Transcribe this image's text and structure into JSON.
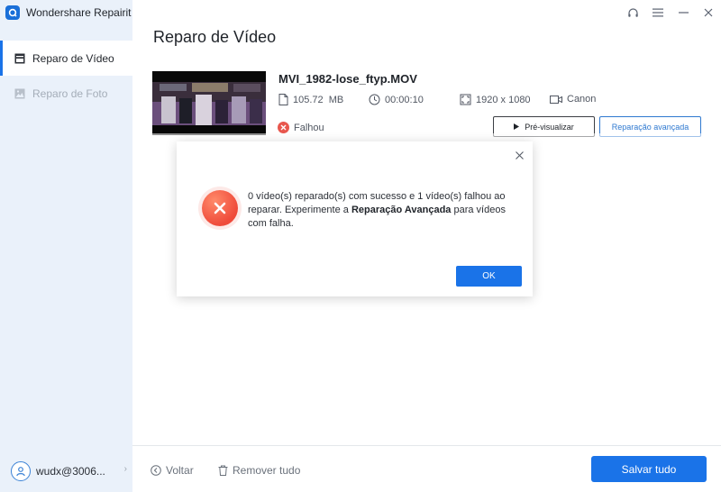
{
  "app": {
    "title": "Wondershare Repairit"
  },
  "sidebar": {
    "items": [
      {
        "label": "Reparo de Vídeo",
        "active": true,
        "icon": "video-repair-icon"
      },
      {
        "label": "Reparo de Foto",
        "active": false,
        "icon": "photo-repair-icon"
      }
    ],
    "user": {
      "name": "wudx@3006...",
      "icon": "user-avatar-icon"
    }
  },
  "window_controls": {
    "icons": [
      "headset-icon",
      "menu-icon",
      "minimize-icon",
      "close-icon"
    ]
  },
  "page": {
    "title": "Reparo de Vídeo"
  },
  "video": {
    "file_name": "MVI_1982-lose_ftyp.MOV",
    "size": "105.72  MB",
    "duration": "00:00:10",
    "resolution": "1920 x 1080",
    "device": "Canon",
    "status": "Falhou",
    "preview_label": "Pré-visualizar",
    "advanced_label": "Reparação avançada"
  },
  "dialog": {
    "message_part1": "0 vídeo(s) reparado(s) com sucesso e 1 vídeo(s) falhou ao reparar. Experimente a ",
    "message_bold": "Reparação Avançada",
    "message_part2": " para vídeos com falha.",
    "ok_label": "OK"
  },
  "footer": {
    "back_label": "Voltar",
    "remove_label": "Remover tudo",
    "save_label": "Salvar tudo"
  },
  "colors": {
    "accent": "#1a73e8",
    "error": "#ef4a3a",
    "sidebar_bg": "#eaf1fa"
  }
}
